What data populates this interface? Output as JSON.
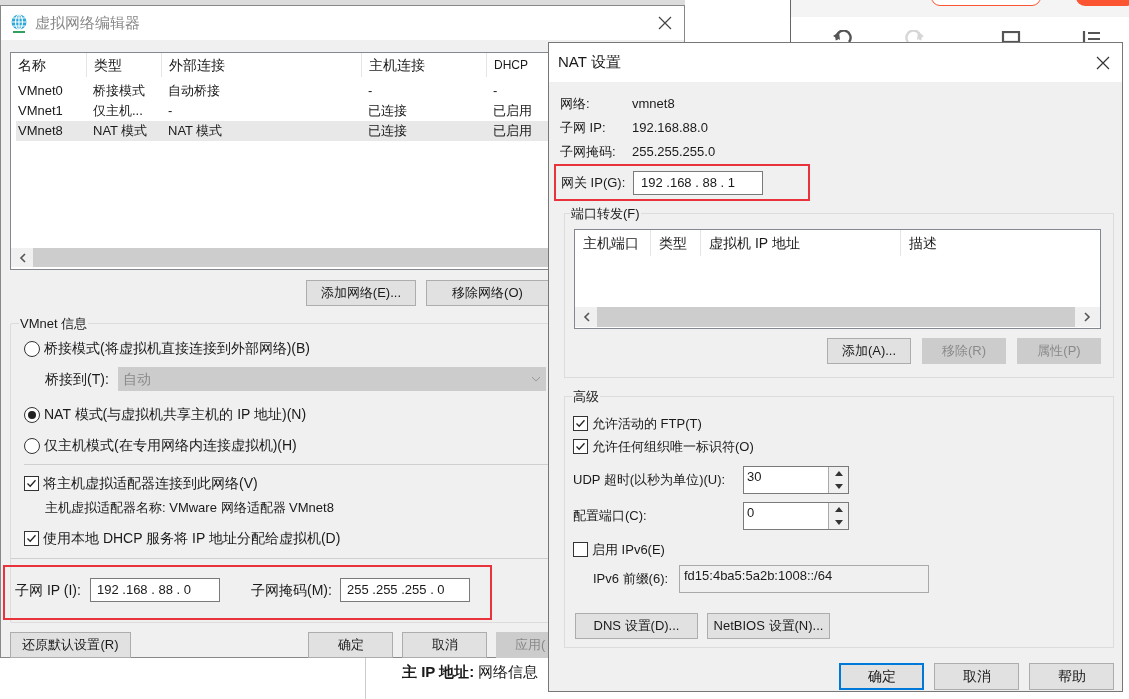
{
  "background": {
    "note": "**主 IP 地址:** 网络信息"
  },
  "editor": {
    "title": "虚拟网络编辑器",
    "table": {
      "columns": [
        "名称",
        "类型",
        "外部连接",
        "主机连接",
        "DHCP"
      ],
      "rows": [
        {
          "cells": [
            "VMnet0",
            "桥接模式",
            "自动桥接",
            "-",
            "-"
          ],
          "selected": false
        },
        {
          "cells": [
            "VMnet1",
            "仅主机...",
            "-",
            "已连接",
            "已启用"
          ],
          "selected": false
        },
        {
          "cells": [
            "VMnet8",
            "NAT 模式",
            "NAT 模式",
            "已连接",
            "已启用"
          ],
          "selected": true
        }
      ]
    },
    "table_buttons": [
      {
        "label": "添加网络(E)..."
      },
      {
        "label": "移除网络(O)"
      }
    ],
    "info": {
      "title": "VMnet 信息",
      "modes": [
        {
          "label": "桥接模式(将虚拟机直接连接到外部网络)(B)",
          "selected": false
        },
        {
          "label": "NAT 模式(与虚拟机共享主机的 IP 地址)(N)",
          "selected": true
        },
        {
          "label": "仅主机模式(在专用网络内连接虚拟机)(H)",
          "selected": false
        }
      ],
      "bridge_to": {
        "label": "桥接到(T):",
        "value": "自动",
        "disabled": true
      },
      "options": [
        {
          "label": "将主机虚拟适配器连接到此网络(V)",
          "checked": true,
          "note": "主机虚拟适配器名称: VMware 网络适配器 VMnet8"
        },
        {
          "label": "使用本地 DHCP 服务将 IP 地址分配给虚拟机(D)",
          "checked": true
        }
      ],
      "subnet": {
        "highlighted": true,
        "ip_label": "子网 IP (I):",
        "ip": "192 .168 . 88 . 0",
        "mask_label": "子网掩码(M):",
        "mask": "255 .255 .255 . 0"
      }
    },
    "footer_buttons": [
      {
        "label": "还原默认设置(R)",
        "disabled": false
      },
      {
        "label": "确定",
        "disabled": false
      },
      {
        "label": "取消",
        "disabled": false
      },
      {
        "label": "应用(",
        "disabled": true
      }
    ]
  },
  "nat": {
    "title": "NAT 设置",
    "info": [
      {
        "label": "网络:",
        "value": "vmnet8"
      },
      {
        "label": "子网 IP:",
        "value": "192.168.88.0"
      },
      {
        "label": "子网掩码:",
        "value": "255.255.255.0"
      }
    ],
    "gateway": {
      "highlighted": true,
      "label": "网关 IP(G):",
      "value": "192 .168 . 88 . 1"
    },
    "port_forwarding": {
      "title": "端口转发(F)",
      "columns": [
        "主机端口",
        "类型",
        "虚拟机 IP 地址",
        "描述"
      ],
      "buttons": [
        {
          "label": "添加(A)...",
          "disabled": false
        },
        {
          "label": "移除(R)",
          "disabled": true
        },
        {
          "label": "属性(P)",
          "disabled": true
        }
      ]
    },
    "advanced": {
      "title": "高级",
      "checkboxes": [
        {
          "label": "允许活动的 FTP(T)",
          "checked": true
        },
        {
          "label": "允许任何组织唯一标识符(O)",
          "checked": true
        }
      ],
      "spinners": [
        {
          "label": "UDP 超时(以秒为单位)(U):",
          "value": "30"
        },
        {
          "label": "配置端口(C):",
          "value": "0"
        }
      ],
      "ipv6": {
        "label": "启用 IPv6(E)",
        "checked": false
      },
      "prefix": {
        "label": "IPv6 前缀(6):",
        "value": "fd15:4ba5:5a2b:1008::/64"
      },
      "buttons": [
        {
          "label": "DNS 设置(D)..."
        },
        {
          "label": "NetBIOS 设置(N)..."
        }
      ]
    },
    "footer_buttons": [
      {
        "label": "确定",
        "default": true
      },
      {
        "label": "取消",
        "default": false
      },
      {
        "label": "帮助",
        "default": false
      }
    ]
  }
}
